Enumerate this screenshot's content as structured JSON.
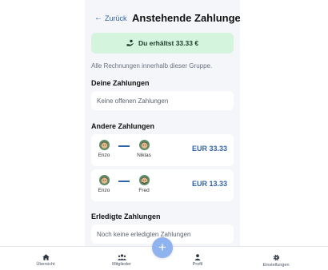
{
  "header": {
    "back_label": "Zurück",
    "title": "Anstehende Zahlungen"
  },
  "banner": {
    "text": "Du erhältst 33.33 €",
    "color": "#d4f4de",
    "icon": "hand-coin-icon"
  },
  "description": "Alle Rechnungen innerhalb dieser Gruppe.",
  "my_payments": {
    "heading": "Deine Zahlungen",
    "empty_text": "Keine offenen Zahlungen"
  },
  "other_payments": {
    "heading": "Andere Zahlungen",
    "items": [
      {
        "from": "Enzo",
        "to": "Niklas",
        "amount": "EUR 33.33"
      },
      {
        "from": "Enzo",
        "to": "Fred",
        "amount": "EUR 13.33"
      }
    ]
  },
  "completed_payments": {
    "heading": "Erledigte Zahlungen",
    "empty_text": "Noch keine erledigten Zahlungen"
  },
  "nav": {
    "items": [
      {
        "label": "Übersicht",
        "icon": "home-icon"
      },
      {
        "label": "Mitglieder",
        "icon": "members-icon"
      },
      {
        "label": "Profil",
        "icon": "profile-icon"
      },
      {
        "label": "Einstellungen",
        "icon": "gear-icon"
      }
    ]
  },
  "fab": {
    "label": "+"
  },
  "colors": {
    "accent": "#2f63a8",
    "fab": "#8fb3ef",
    "panel": "#f4f6f9"
  }
}
